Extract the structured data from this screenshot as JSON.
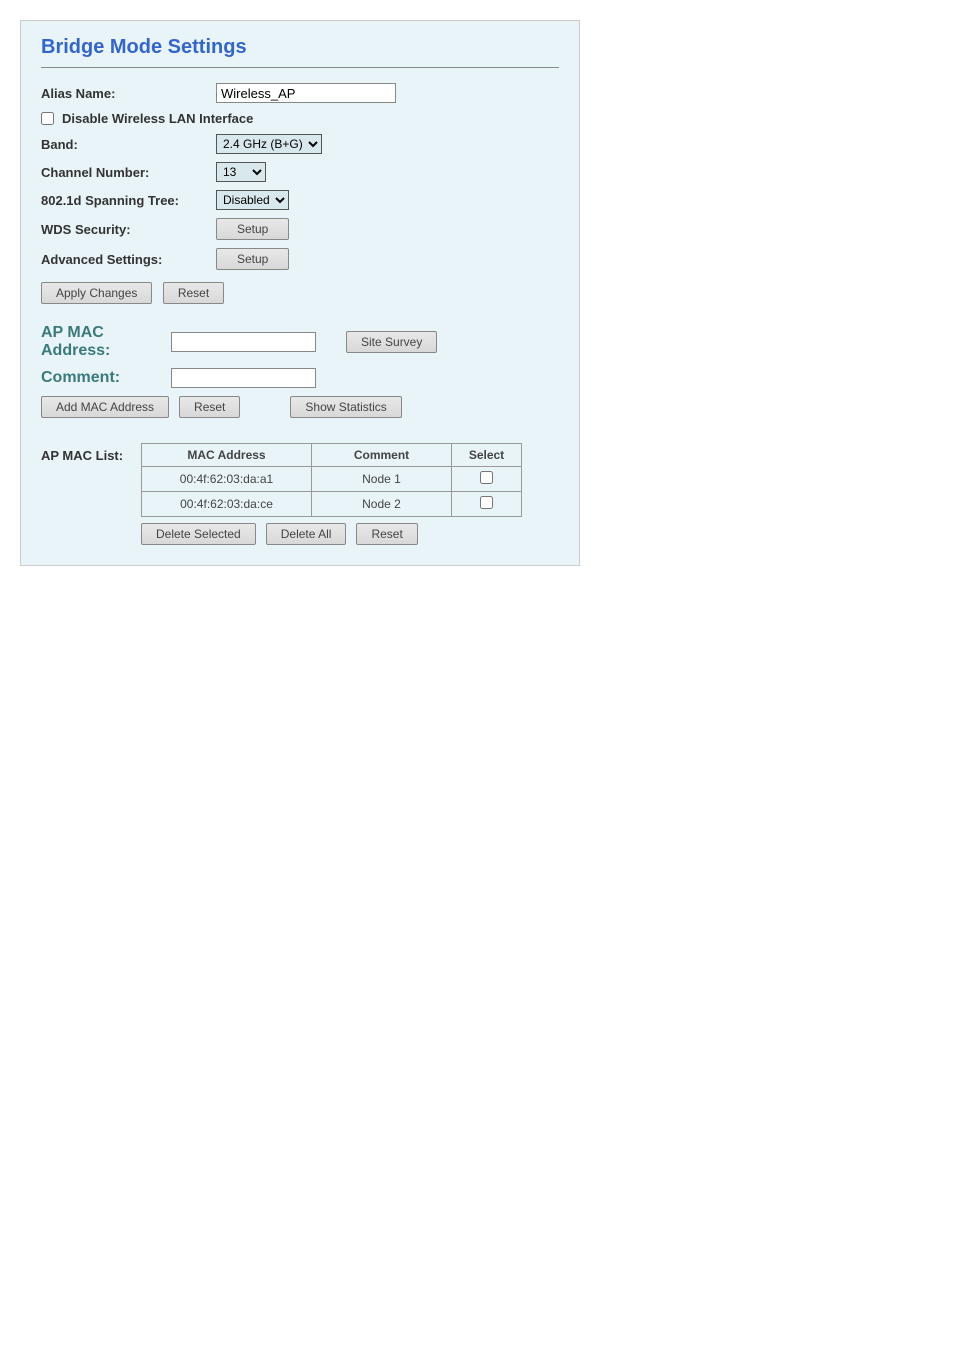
{
  "title": "Bridge Mode Settings",
  "fields": {
    "alias_name": {
      "label": "Alias Name:",
      "value": "Wireless_AP"
    },
    "disable_wlan": {
      "label": "Disable Wireless LAN Interface"
    },
    "band": {
      "label": "Band:",
      "value": "2.4 GHz (B+G)"
    },
    "channel": {
      "label": "Channel Number:",
      "value": "13"
    },
    "spanning_tree": {
      "label": "802.1d Spanning Tree:",
      "value": "Disabled"
    },
    "wds_security": {
      "label": "WDS Security:",
      "button": "Setup"
    },
    "advanced": {
      "label": "Advanced Settings:",
      "button": "Setup"
    }
  },
  "buttons": {
    "apply_changes": "Apply Changes",
    "reset1": "Reset",
    "site_survey": "Site Survey",
    "add_mac": "Add MAC Address",
    "reset2": "Reset",
    "show_stats": "Show Statistics",
    "delete_selected": "Delete Selected",
    "delete_all": "Delete All",
    "reset3": "Reset"
  },
  "mac_section": {
    "ap_mac_label": "AP MAC Address:",
    "comment_label": "Comment:"
  },
  "table": {
    "label": "AP MAC List:",
    "headers": {
      "mac": "MAC Address",
      "comment": "Comment",
      "select": "Select"
    },
    "rows": [
      {
        "mac": "00:4f:62:03:da:a1",
        "comment": "Node 1"
      },
      {
        "mac": "00:4f:62:03:da:ce",
        "comment": "Node 2"
      }
    ]
  }
}
